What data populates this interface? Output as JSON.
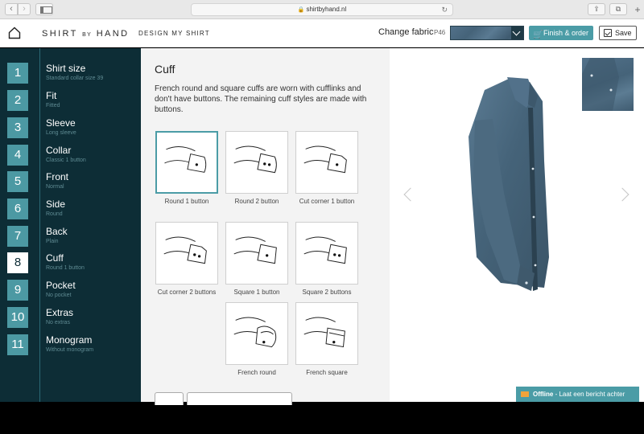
{
  "browser": {
    "url": "shirtbyhand.nl",
    "back_glyph": "‹",
    "forward_glyph": "›",
    "lock_glyph": "🔒",
    "reload_glyph": "↻",
    "share_glyph": "⇪",
    "tabs_glyph": "⧉",
    "plus_glyph": "+"
  },
  "header": {
    "logo_part1": "SHIRT",
    "logo_part2": "BY",
    "logo_part3": "HAND",
    "nav_link": "DESIGN MY SHIRT",
    "change_fabric_label": "Change fabric",
    "fabric_code": "P46",
    "finish_label": "Finish & order",
    "cart_glyph": "🛒",
    "save_label": "Save"
  },
  "steps": [
    {
      "num": "1",
      "title": "Shirt size",
      "sub": "Standard collar size 39"
    },
    {
      "num": "2",
      "title": "Fit",
      "sub": "Fitted"
    },
    {
      "num": "3",
      "title": "Sleeve",
      "sub": "Long sleeve"
    },
    {
      "num": "4",
      "title": "Collar",
      "sub": "Classic 1 button"
    },
    {
      "num": "5",
      "title": "Front",
      "sub": "Normal"
    },
    {
      "num": "6",
      "title": "Side",
      "sub": "Round"
    },
    {
      "num": "7",
      "title": "Back",
      "sub": "Plain"
    },
    {
      "num": "8",
      "title": "Cuff",
      "sub": "Round 1 button",
      "active": true
    },
    {
      "num": "9",
      "title": "Pocket",
      "sub": "No pocket"
    },
    {
      "num": "10",
      "title": "Extras",
      "sub": "No extras"
    },
    {
      "num": "11",
      "title": "Monogram",
      "sub": "Without monogram"
    }
  ],
  "panel": {
    "title": "Cuff",
    "description": "French round and square cuffs are worn with cufflinks and don't have buttons. The remaining cuff styles are made with buttons.",
    "options": [
      {
        "label": "Round 1 button",
        "selected": true
      },
      {
        "label": "Round 2 button"
      },
      {
        "label": "Cut corner 1 button"
      },
      {
        "label": "Cut corner 2 buttons"
      },
      {
        "label": "Square 1 button"
      },
      {
        "label": "Square 2 buttons"
      },
      {
        "label": "French round"
      },
      {
        "label": "French square"
      }
    ]
  },
  "chat": {
    "status": "Offline",
    "message": " - Laat een bericht achter"
  },
  "colors": {
    "sidebar_bg": "#0d2d36",
    "accent": "#4b9ca6",
    "shirt_fabric": "#456379"
  }
}
